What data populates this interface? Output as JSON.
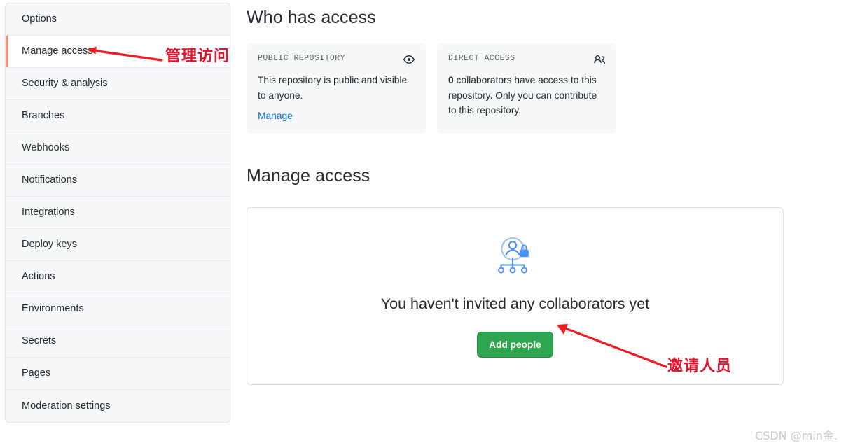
{
  "sidebar": {
    "items": [
      {
        "label": "Options",
        "active": false
      },
      {
        "label": "Manage access",
        "active": true
      },
      {
        "label": "Security & analysis",
        "active": false
      },
      {
        "label": "Branches",
        "active": false
      },
      {
        "label": "Webhooks",
        "active": false
      },
      {
        "label": "Notifications",
        "active": false
      },
      {
        "label": "Integrations",
        "active": false
      },
      {
        "label": "Deploy keys",
        "active": false
      },
      {
        "label": "Actions",
        "active": false
      },
      {
        "label": "Environments",
        "active": false
      },
      {
        "label": "Secrets",
        "active": false
      },
      {
        "label": "Pages",
        "active": false
      },
      {
        "label": "Moderation settings",
        "active": false
      }
    ],
    "active_indicator_color": "#fd8c73"
  },
  "main": {
    "who_has_access": {
      "title": "Who has access",
      "cards": [
        {
          "label": "PUBLIC REPOSITORY",
          "icon": "eye-icon",
          "body": "This repository is public and visible to anyone.",
          "link": "Manage"
        },
        {
          "label": "DIRECT ACCESS",
          "icon": "people-icon",
          "count": "0",
          "body_rest": " collaborators have access to this repository. Only you can contribute to this repository."
        }
      ]
    },
    "manage_access": {
      "title": "Manage access",
      "empty_state": {
        "illustration": "people-lock-hierarchy-icon",
        "heading": "You haven't invited any collaborators yet",
        "button_label": "Add people",
        "button_color": "#2da44e"
      }
    }
  },
  "annotations": {
    "color": "#e8112d",
    "sidebar_note": "管理访问",
    "add_people_note": "邀请人员"
  },
  "watermark": "CSDN @min金."
}
